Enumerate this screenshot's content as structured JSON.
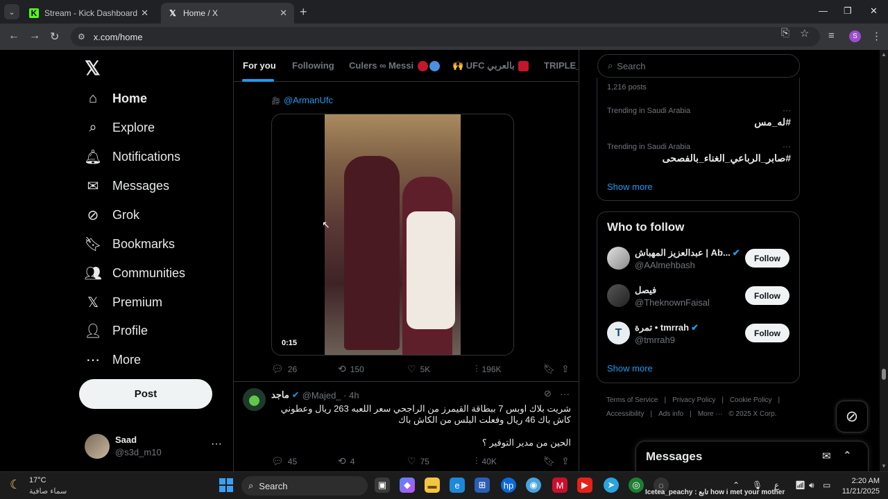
{
  "browser": {
    "tabs": [
      {
        "title": "Stream - Kick Dashboard",
        "favicon": "kick-icon",
        "active": false
      },
      {
        "title": "Home / X",
        "favicon": "x-logo-icon",
        "active": true
      }
    ],
    "url": "x.com/home",
    "profile_initial": "S"
  },
  "nav": {
    "items": [
      {
        "label": "Home",
        "icon": "home-icon"
      },
      {
        "label": "Explore",
        "icon": "search-icon"
      },
      {
        "label": "Notifications",
        "icon": "bell-icon"
      },
      {
        "label": "Messages",
        "icon": "envelope-icon"
      },
      {
        "label": "Grok",
        "icon": "grok-icon"
      },
      {
        "label": "Bookmarks",
        "icon": "bookmark-icon"
      },
      {
        "label": "Communities",
        "icon": "people-icon"
      },
      {
        "label": "Premium",
        "icon": "x-logo-icon"
      },
      {
        "label": "Profile",
        "icon": "person-icon"
      },
      {
        "label": "More",
        "icon": "more-circle-icon"
      }
    ],
    "post_label": "Post",
    "account": {
      "name": "Saad",
      "handle": "@s3d_m10"
    }
  },
  "timeline": {
    "tabs": [
      "For you",
      "Following",
      "Culers ∞ Messi",
      "🙌 UFC بالعربي",
      "TRIPLE_X"
    ],
    "active_tab": "For you",
    "tweet1": {
      "credit": "@ArmanUfc",
      "video_time": "0:15",
      "stats": {
        "replies": "26",
        "reposts": "150",
        "likes": "5K",
        "views": "196K"
      }
    },
    "tweet2": {
      "name": "ماجد",
      "handle": "@Majed_",
      "time": "4h",
      "text": "شريت بلاك اوبس 7 ببطاقة القيمرز من  الراجحي سعر اللعبه 263 ريال وعطوني كاش باك 46 ريال وفعلت البلس من الكاش باك",
      "text2": "الحين من مدير التوفير ؟",
      "stats": {
        "replies": "45",
        "reposts": "4",
        "likes": "75",
        "views": "40K"
      }
    }
  },
  "right": {
    "search_placeholder": "Search",
    "trend_posts": "1,216 posts",
    "trends": [
      {
        "context": "Trending in Saudi Arabia",
        "tag": "#له_مس"
      },
      {
        "context": "Trending in Saudi Arabia",
        "tag": "#صابر_الرباعي_الغناء_بالفصحى"
      }
    ],
    "show_more": "Show more",
    "who_to_follow": {
      "title": "Who to follow",
      "accounts": [
        {
          "name": "عبدالعزيز المهباش | Ab...",
          "handle": "@AAlmehbash",
          "verified": true
        },
        {
          "name": "فيصل",
          "handle": "@TheknownFaisal",
          "verified": false
        },
        {
          "name": "تمرة • tmrrah",
          "handle": "@tmrrah9",
          "verified": true
        }
      ],
      "follow_label": "Follow",
      "show_more": "Show more"
    },
    "footer": [
      "Terms of Service",
      "|",
      "Privacy Policy",
      "|",
      "Cookie Policy",
      "|",
      "Accessibility",
      "|",
      "Ads info",
      "|",
      "More ···",
      "© 2025 X Corp."
    ],
    "messages_label": "Messages"
  },
  "taskbar": {
    "weather_temp": "17°C",
    "weather_cond": "سماء صافية",
    "search_label": "Search",
    "media_text": "Icetea_peachy : تابع how i met your mother",
    "time": "2:20 AM",
    "date": "11/21/2025",
    "tray_lang": "ع"
  },
  "colors": {
    "accent": "#1d9bf0",
    "background": "#000000",
    "border": "#2f3336"
  }
}
